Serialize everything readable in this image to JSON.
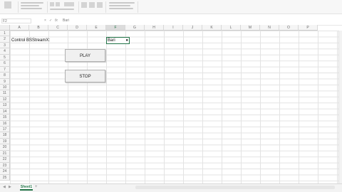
{
  "formula_bar": {
    "name_box": "F2",
    "cancel_icon": "×",
    "confirm_icon": "✓",
    "fx_label": "fx",
    "content": "Bari"
  },
  "columns": [
    "A",
    "B",
    "C",
    "D",
    "E",
    "F",
    "G",
    "H",
    "I",
    "J",
    "K",
    "L",
    "M",
    "N",
    "O",
    "P"
  ],
  "selected_column": "F",
  "rows": [
    "1",
    "2",
    "3",
    "4",
    "5",
    "6",
    "7",
    "8",
    "9",
    "10",
    "11",
    "12",
    "13",
    "14",
    "15",
    "16",
    "17",
    "18",
    "19",
    "20",
    "21",
    "22",
    "23",
    "24",
    "25"
  ],
  "cells": {
    "a2": "Control BSStreamX:",
    "f2": "Bari"
  },
  "buttons": {
    "play": "PLAY",
    "stop": "STOP"
  },
  "sheet": {
    "tab": "Sheet1",
    "add": "+"
  },
  "colors": {
    "accent": "#217346"
  }
}
